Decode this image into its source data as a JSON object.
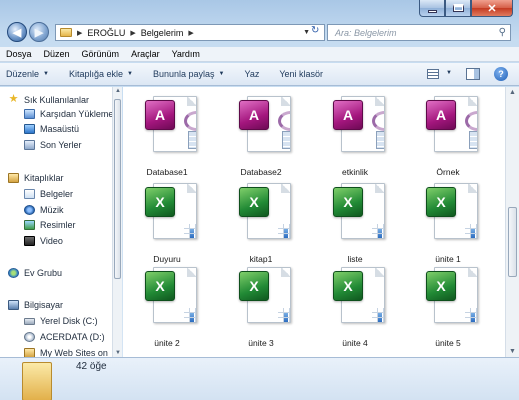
{
  "window": {
    "caption_buttons": [
      "minimize",
      "maximize",
      "close"
    ]
  },
  "address": {
    "crumbs": [
      "EROĞLU",
      "Belgelerim"
    ],
    "search_placeholder": "Ara: Belgelerim"
  },
  "menu": {
    "items": [
      "Dosya",
      "Düzen",
      "Görünüm",
      "Araçlar",
      "Yardım"
    ]
  },
  "toolbar": {
    "organize": "Düzenle",
    "add_to_library": "Kitaplığa ekle",
    "share_with": "Bununla paylaş",
    "print": "Yaz",
    "new_folder": "Yeni klasör"
  },
  "nav": {
    "favorites": "Sık Kullanılanlar",
    "downloads": "Karşıdan Yüklemeler",
    "desktop": "Masaüstü",
    "recent": "Son Yerler",
    "libraries": "Kitaplıklar",
    "documents": "Belgeler",
    "music": "Müzik",
    "pictures": "Resimler",
    "video": "Video",
    "homegroup": "Ev Grubu",
    "computer": "Bilgisayar",
    "local_disk": "Yerel Disk (C:)",
    "acerdata": "ACERDATA (D:)",
    "web_sites": "My Web Sites on"
  },
  "files": [
    {
      "name": "Database1",
      "type": "access"
    },
    {
      "name": "Database2",
      "type": "access"
    },
    {
      "name": "etkinlik",
      "type": "access"
    },
    {
      "name": "Örnek",
      "type": "access"
    },
    {
      "name": "Duyuru",
      "type": "excel"
    },
    {
      "name": "kitap1",
      "type": "excel"
    },
    {
      "name": "liste",
      "type": "excel"
    },
    {
      "name": "ünite 1",
      "type": "excel"
    },
    {
      "name": "ünite 2",
      "type": "excel"
    },
    {
      "name": "ünite 3",
      "type": "excel"
    },
    {
      "name": "ünite 4",
      "type": "excel"
    },
    {
      "name": "ünite 5",
      "type": "excel"
    }
  ],
  "details": {
    "item_count": "42 öğe"
  },
  "colors": {
    "access": "#a4167e",
    "excel": "#218a35",
    "title_glass": "#a9c7e6"
  }
}
